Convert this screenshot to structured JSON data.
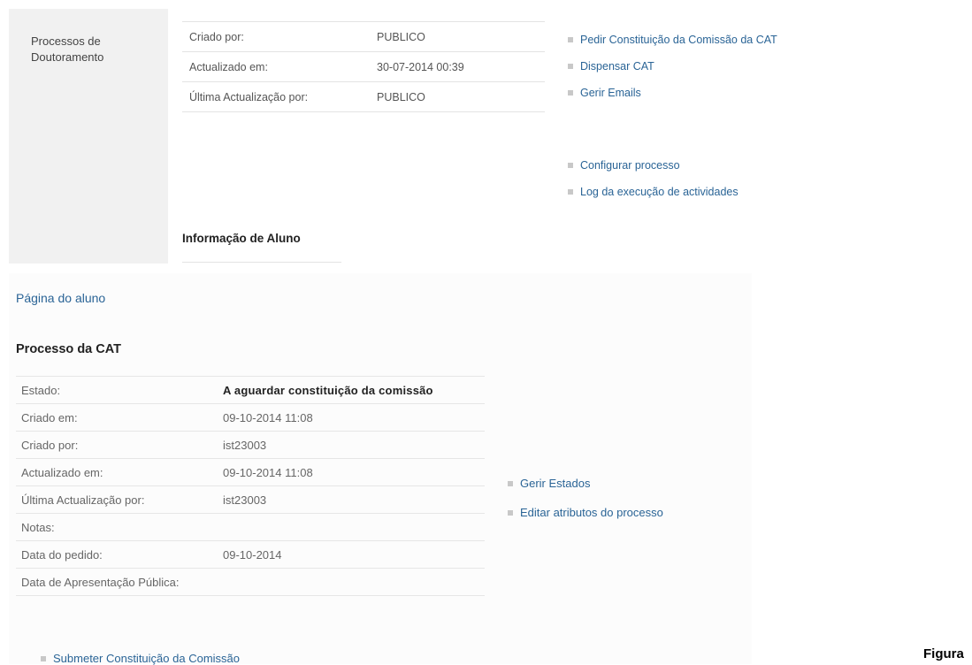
{
  "top": {
    "sidebar_label_line1": "Processos de",
    "sidebar_label_line2": "Doutoramento",
    "rows": [
      {
        "key": "Criado por:",
        "value": "PUBLICO"
      },
      {
        "key": "Actualizado em:",
        "value": "30-07-2014 00:39"
      },
      {
        "key": "Última Actualização por:",
        "value": "PUBLICO"
      }
    ],
    "links": [
      "Pedir Constituição da Comissão da CAT",
      "Dispensar CAT",
      "Gerir Emails",
      "Configurar processo",
      "Log da execução de actividades"
    ],
    "section_heading": "Informação de Aluno"
  },
  "bottom": {
    "student_page_link": "Página do aluno",
    "heading": "Processo da CAT",
    "rows": [
      {
        "key": "Estado:",
        "value": "A aguardar constituição da comissão"
      },
      {
        "key": "Criado em:",
        "value": "09-10-2014 11:08"
      },
      {
        "key": "Criado por:",
        "value": "ist23003"
      },
      {
        "key": "Actualizado em:",
        "value": "09-10-2014 11:08"
      },
      {
        "key": "Última Actualização por:",
        "value": "ist23003"
      },
      {
        "key": "Notas:",
        "value": ""
      },
      {
        "key": "Data do pedido:",
        "value": "09-10-2014"
      },
      {
        "key": "Data de Apresentação Pública:",
        "value": ""
      }
    ],
    "links": [
      "Gerir Estados",
      "Editar atributos do processo"
    ],
    "submit_link": "Submeter Constituição da Comissão"
  },
  "caption_fragment": "Figura"
}
